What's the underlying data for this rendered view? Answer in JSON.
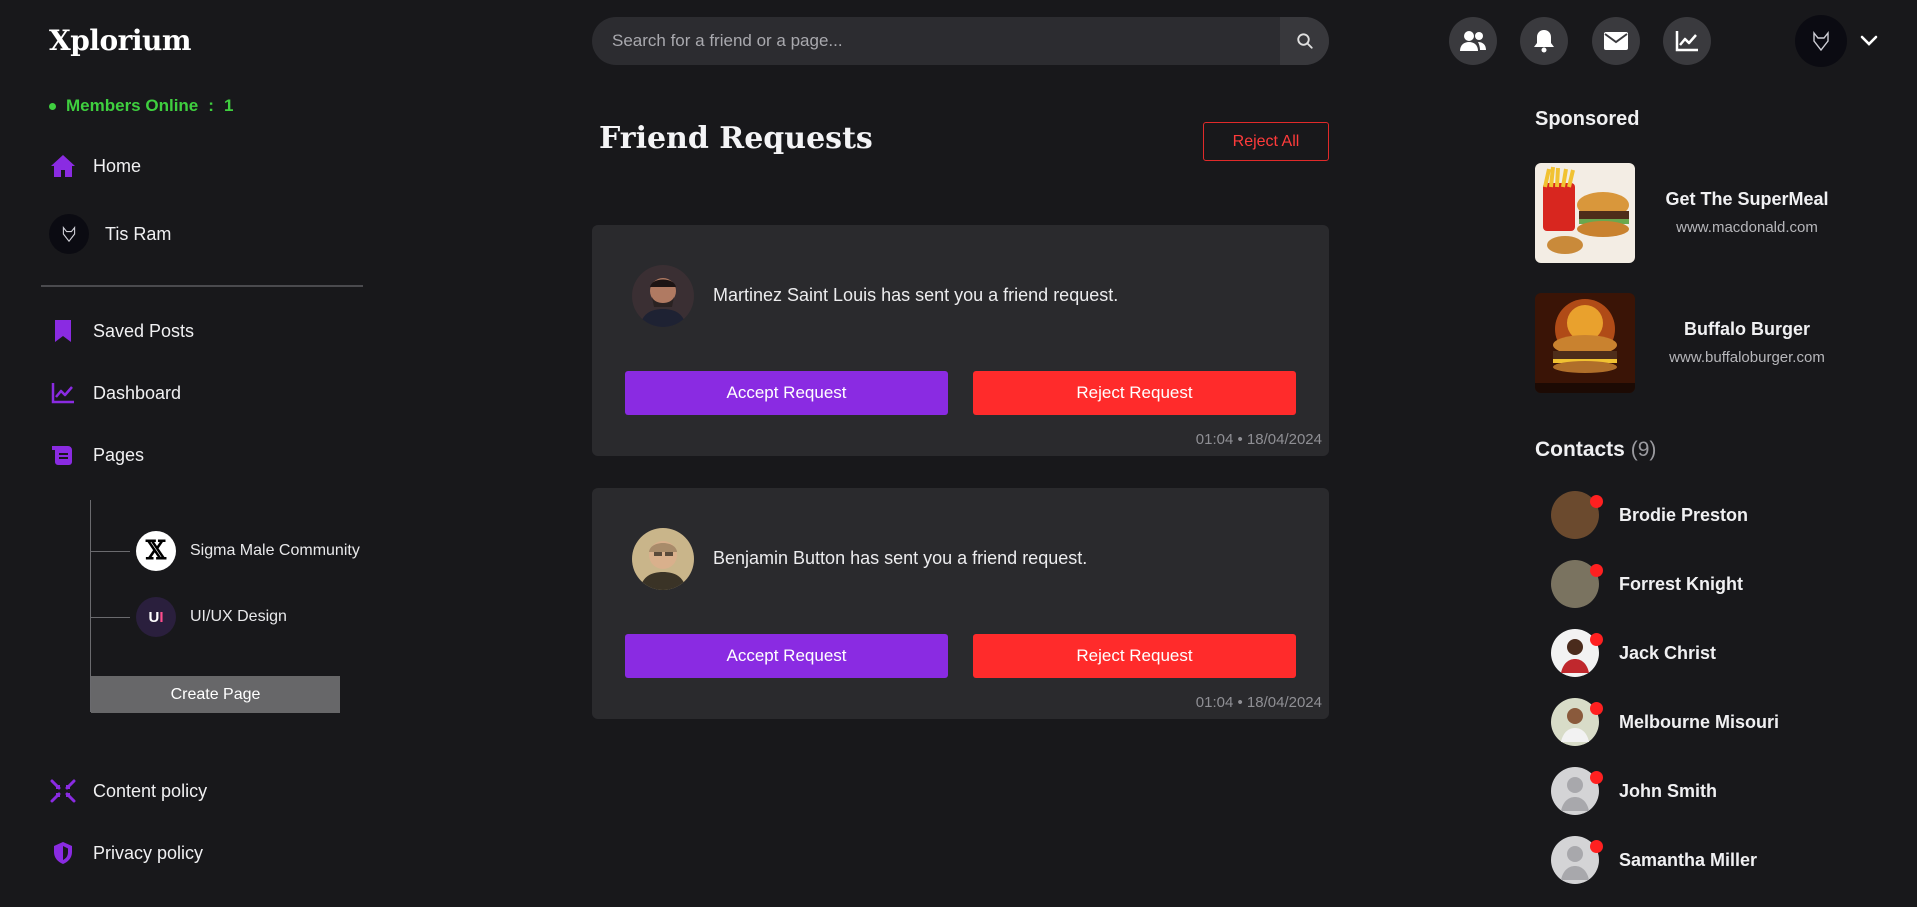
{
  "header": {
    "logo": "Xplorium",
    "search_placeholder": "Search for a friend or a page...",
    "icons": [
      "friends-icon",
      "bell-icon",
      "mail-icon",
      "chart-icon"
    ]
  },
  "sidebar": {
    "online_label": "Members Online",
    "online_sep": ":",
    "online_count": "1",
    "home": "Home",
    "user_name": "Tis Ram",
    "saved_posts": "Saved Posts",
    "dashboard": "Dashboard",
    "pages": "Pages",
    "page_items": [
      {
        "name": "Sigma Male Community"
      },
      {
        "name": "UI/UX Design"
      }
    ],
    "create_page": "Create Page",
    "content_policy": "Content policy",
    "privacy_policy": "Privacy policy"
  },
  "main": {
    "title": "Friend Requests",
    "reject_all": "Reject All",
    "requests": [
      {
        "text": "Martinez Saint Louis has sent you a friend request.",
        "accept": "Accept Request",
        "reject": "Reject Request",
        "time": "01:04 • 18/04/2024"
      },
      {
        "text": "Benjamin Button has sent you a friend request.",
        "accept": "Accept Request",
        "reject": "Reject Request",
        "time": "01:04 • 18/04/2024"
      }
    ]
  },
  "right": {
    "sponsored_title": "Sponsored",
    "ads": [
      {
        "name": "Get The SuperMeal",
        "url": "www.macdonald.com"
      },
      {
        "name": "Buffalo Burger",
        "url": "www.buffaloburger.com"
      }
    ],
    "contacts_title": "Contacts",
    "contacts_count": "(9)",
    "contacts": [
      {
        "name": "Brodie Preston"
      },
      {
        "name": "Forrest Knight"
      },
      {
        "name": "Jack Christ"
      },
      {
        "name": "Melbourne Misouri"
      },
      {
        "name": "John Smith"
      },
      {
        "name": "Samantha Miller"
      }
    ]
  },
  "colors": {
    "accent": "#8a2be2",
    "danger": "#ff2b2b",
    "online": "#3fcf3f",
    "background": "#18181b",
    "card": "#2a2a2d"
  }
}
